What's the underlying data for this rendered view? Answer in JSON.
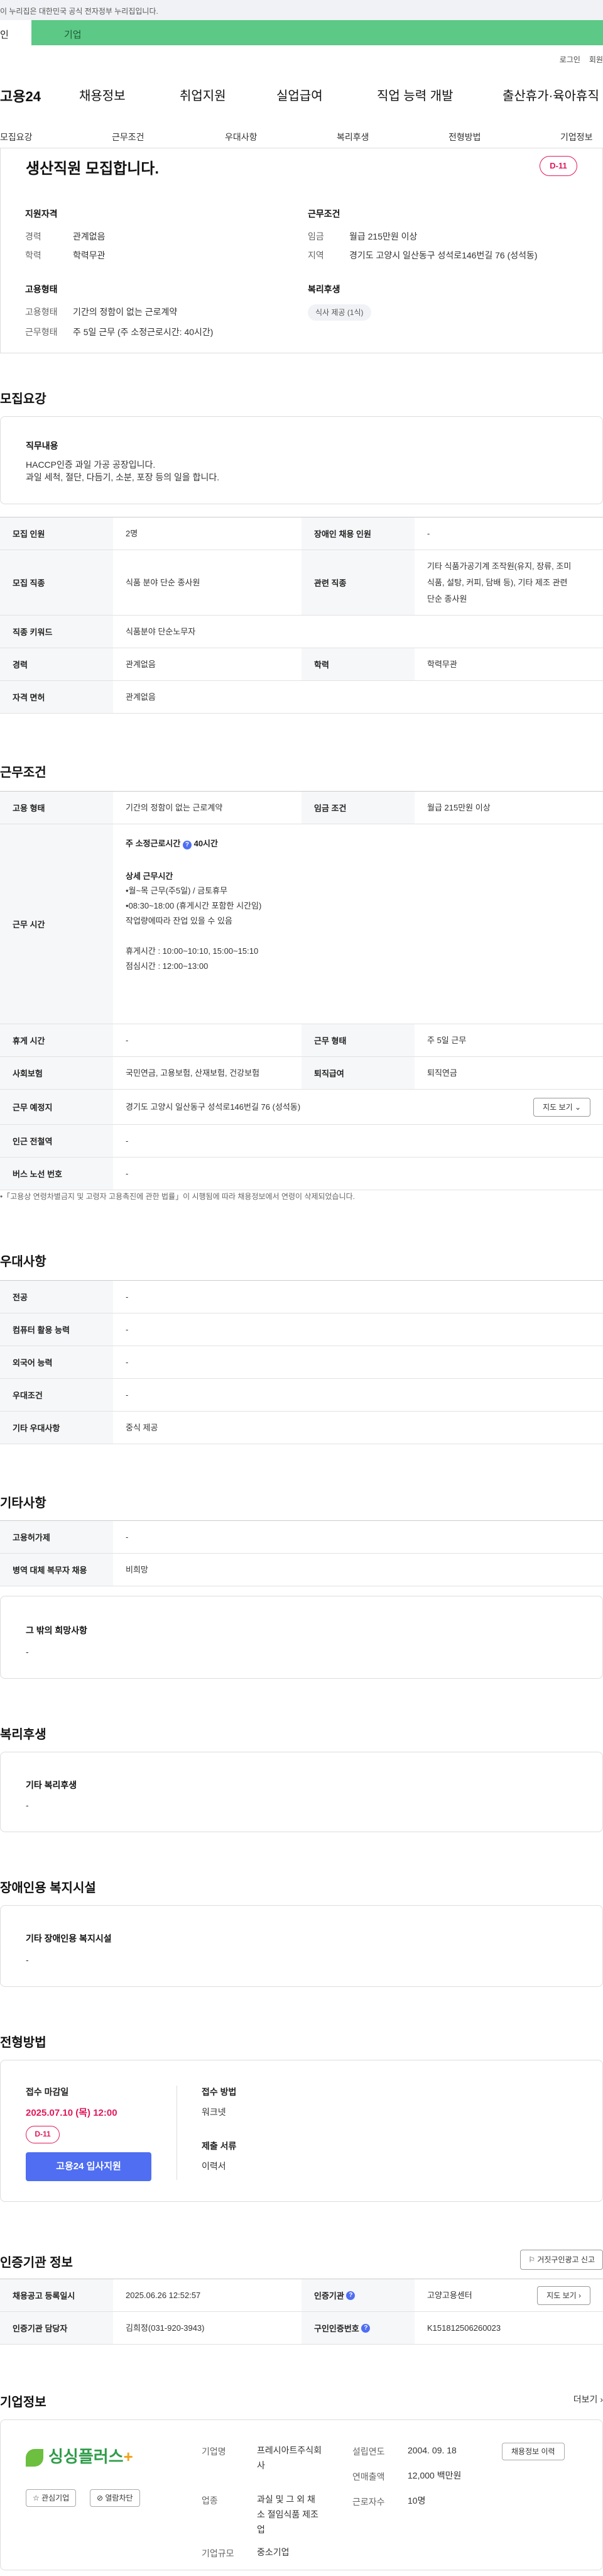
{
  "gov_bar": "이 누리집은 대한민국 공식 전자정부 누리집입니다.",
  "tabs": {
    "individual": "인",
    "business": "기업"
  },
  "util": {
    "login": "로그인",
    "join": "회원"
  },
  "gnb": {
    "logo": "고용24",
    "items": [
      "채용정보",
      "취업지원",
      "실업급여",
      "직업 능력 개발",
      "출산휴가·육아휴직"
    ]
  },
  "subnav": [
    "모집요강",
    "근무조건",
    "우대사항",
    "복리후생",
    "전형방법",
    "기업정보"
  ],
  "title": "생산직원 모집합니다.",
  "dday": "D-11",
  "summary": {
    "qual_title": "지원자격",
    "career_k": "경력",
    "career_v": "관계없음",
    "edu_k": "학력",
    "edu_v": "학력무관",
    "cond_title": "근무조건",
    "wage_k": "임금",
    "wage_v": "월급 215만원 이상",
    "region_k": "지역",
    "region_v": "경기도 고양시 일산동구 성석로146번길 76 (성석동)",
    "emp_title": "고용형태",
    "etype_k": "고용형태",
    "etype_v": "기간의 정함이 없는 근로계약",
    "wtype_k": "근무형태",
    "wtype_v": "주 5일 근무 (주 소정근로시간: 40시간)",
    "welfare_title": "복리후생",
    "welfare_chip": "식사 제공 (1식)"
  },
  "recruit": {
    "heading": "모집요강",
    "duty_title": "직무내용",
    "duty_text": "HACCP인증 과일 가공 공장입니다.\n과일 세척, 절단, 다듬기, 소분, 포장 등의 일을 합니다.",
    "rows": {
      "count_k": "모집 인원",
      "count_v": "2명",
      "disabled_k": "장애인 채용 인원",
      "disabled_v": "-",
      "job_k": "모집 직종",
      "job_v": "식품 분야 단순 종사원",
      "rel_k": "관련 직종",
      "rel_v": "기타 식품가공기계 조작원(유지, 장류, 조미\n식품, 설탕, 커피, 담배 등), 기타 제조 관련\n단순 종사원",
      "kw_k": "직종 키워드",
      "kw_v": "식품분야 단순노무자",
      "career_k": "경력",
      "career_v": "관계없음",
      "edu_k": "학력",
      "edu_v": "학력무관",
      "lic_k": "자격 면허",
      "lic_v": "관계없음"
    }
  },
  "conditions": {
    "heading": "근무조건",
    "etype_k": "고용 형태",
    "etype_v": "기간의 정함이 없는 근로계약",
    "wage_k": "임금 조건",
    "wage_v": "월급 215만원 이상",
    "time_k": "근무 시간",
    "time_lines": {
      "hours": "주 소정근로시간",
      "hours_val": "40시간",
      "detail_title": "상세 근무시간",
      "detail": "•월~목 근무(주5일) / 금토휴무\n•08:30~18:00 (휴게시간 포함한 시간임)\n   작업량에따라 잔업 있을 수 있음\n\n휴게시간 : 10:00~10:10, 15:00~15:10\n점심시간 : 12:00~13:00"
    },
    "break_k": "휴게 시간",
    "break_v": "-",
    "wform_k": "근무 형태",
    "wform_v": "주 5일 근무",
    "ins_k": "사회보험",
    "ins_v": "국민연금, 고용보험, 산재보험, 건강보험",
    "sev_k": "퇴직급여",
    "sev_v": "퇴직연금",
    "place_k": "근무 예정지",
    "place_v": "경기도 고양시 일산동구 성석로146번길 76 (성석동)",
    "map_btn": "지도 보기 ⌄",
    "subway_k": "인근 전철역",
    "subway_v": "-",
    "bus_k": "버스 노선 번호",
    "bus_v": "-",
    "note": "•「고용상 연령차별금지 및 고령자 고용촉진에 관한 법률」이 시행됨에 따라 채용정보에서 연령이 삭제되었습니다."
  },
  "pref": {
    "heading": "우대사항",
    "major_k": "전공",
    "major_v": "-",
    "pc_k": "컴퓨터 활용 능력",
    "pc_v": "-",
    "lang_k": "외국어 능력",
    "lang_v": "-",
    "cond_k": "우대조건",
    "cond_v": "-",
    "etc_k": "기타 우대사항",
    "etc_v": "중식 제공"
  },
  "other": {
    "heading": "기타사항",
    "permit_k": "고용허가제",
    "permit_v": "-",
    "mil_k": "병역 대체 복무자 채용",
    "mil_v": "비희망",
    "hope_title": "그 밖의 희망사항",
    "hope_v": "-"
  },
  "welfare": {
    "heading": "복리후생",
    "title": "기타 복리후생",
    "value": "-"
  },
  "facility": {
    "heading": "장애인용 복지시설",
    "title": "기타 장애인용 복지시설",
    "value": "-"
  },
  "process": {
    "heading": "전형방법",
    "deadline_title": "접수 마감일",
    "deadline": "2025.07.10 (목) 12:00",
    "dday": "D-11",
    "apply": "고용24 입사지원",
    "method_title": "접수 방법",
    "method_v": "워크넷",
    "docs_title": "제출 서류",
    "docs_v": "이력서"
  },
  "cert": {
    "heading": "인증기관 정보",
    "report_btn": "거짓구인광고 신고",
    "reg_k": "채용공고 등록일시",
    "reg_v": "2025.06.26 12:52:57",
    "org_k": "인증기관",
    "org_v": "고양고용센터",
    "map_btn": "지도 보기 ›",
    "mgr_k": "인증기관 담당자",
    "mgr_v": "김희정(031-920-3943)",
    "num_k": "구인인증번호",
    "num_v": "K151812506260023"
  },
  "company": {
    "heading": "기업정보",
    "more": "더보기 ›",
    "logo": "싱싱플러스",
    "fav": "☆ 관심기업",
    "block": "⊘ 열람차단",
    "name_k": "기업명",
    "name_v": "프레시아트주식회\n사",
    "ind_k": "업종",
    "ind_v": "과실 및 그 외 채\n소 절임식품 제조\n업",
    "size_k": "기업규모",
    "size_v": "중소기업",
    "est_k": "설립연도",
    "est_v": "2004. 09. 18",
    "sales_k": "연매출액",
    "sales_v": "12,000 백만원",
    "emp_k": "근로자수",
    "emp_v": "10명",
    "jobs_btn": "채용정보 이력"
  }
}
